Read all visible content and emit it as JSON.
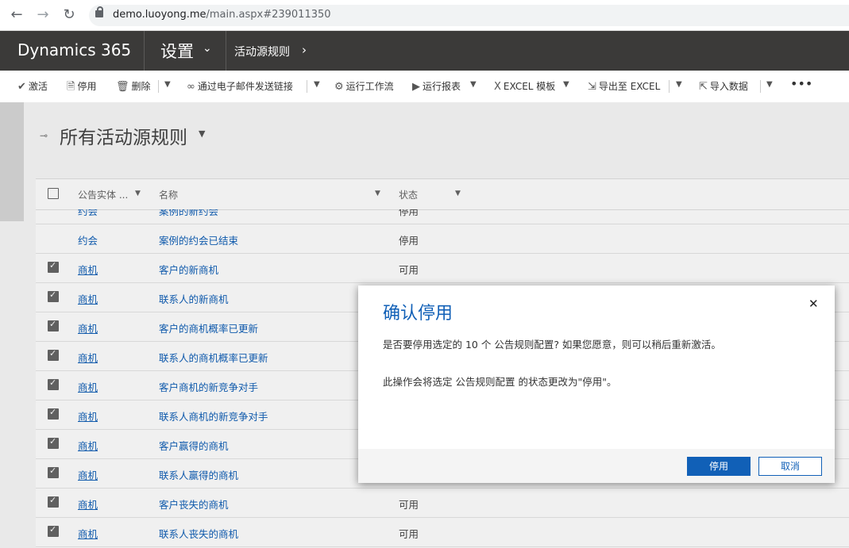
{
  "browser": {
    "url_domain": "demo.luoyong.me",
    "url_path": "/main.aspx#239011350"
  },
  "header": {
    "brand": "Dynamics 365",
    "area": "设置",
    "entity": "活动源规则"
  },
  "commands": [
    {
      "icon": "check-icon",
      "label": "激活"
    },
    {
      "icon": "deactivate-icon",
      "label": "停用"
    },
    {
      "icon": "trash-icon",
      "label": "删除"
    },
    {
      "icon": "link-icon",
      "label": "通过电子邮件发送链接"
    },
    {
      "icon": "workflow-icon",
      "label": "运行工作流"
    },
    {
      "icon": "report-icon",
      "label": "运行报表"
    },
    {
      "icon": "excel-icon",
      "label": "EXCEL 模板"
    },
    {
      "icon": "export-icon",
      "label": "导出至 EXCEL"
    },
    {
      "icon": "import-icon",
      "label": "导入数据"
    }
  ],
  "view": {
    "title": "所有活动源规则"
  },
  "grid": {
    "columns": [
      "公告实体 ...",
      "名称",
      "状态"
    ],
    "rows": [
      {
        "entity": "约会",
        "name": "案例的新约会",
        "status": "停用",
        "checked": false
      },
      {
        "entity": "约会",
        "name": "案例的约会已结束",
        "status": "停用",
        "checked": false
      },
      {
        "entity": "商机",
        "name": "客户的新商机",
        "status": "可用",
        "checked": true
      },
      {
        "entity": "商机",
        "name": "联系人的新商机",
        "status": "",
        "checked": true
      },
      {
        "entity": "商机",
        "name": "客户的商机概率已更新",
        "status": "",
        "checked": true
      },
      {
        "entity": "商机",
        "name": "联系人的商机概率已更新",
        "status": "",
        "checked": true
      },
      {
        "entity": "商机",
        "name": "客户商机的新竞争对手",
        "status": "",
        "checked": true
      },
      {
        "entity": "商机",
        "name": "联系人商机的新竞争对手",
        "status": "",
        "checked": true
      },
      {
        "entity": "商机",
        "name": "客户赢得的商机",
        "status": "",
        "checked": true
      },
      {
        "entity": "商机",
        "name": "联系人赢得的商机",
        "status": "",
        "checked": true
      },
      {
        "entity": "商机",
        "name": "客户丧失的商机",
        "status": "可用",
        "checked": true
      },
      {
        "entity": "商机",
        "name": "联系人丧失的商机",
        "status": "可用",
        "checked": true
      }
    ]
  },
  "dialog": {
    "title": "确认停用",
    "message1": "是否要停用选定的 10 个 公告规则配置? 如果您愿意，则可以稍后重新激活。",
    "message2": "此操作会将选定 公告规则配置 的状态更改为\"停用\"。",
    "confirm_label": "停用",
    "cancel_label": "取消"
  }
}
